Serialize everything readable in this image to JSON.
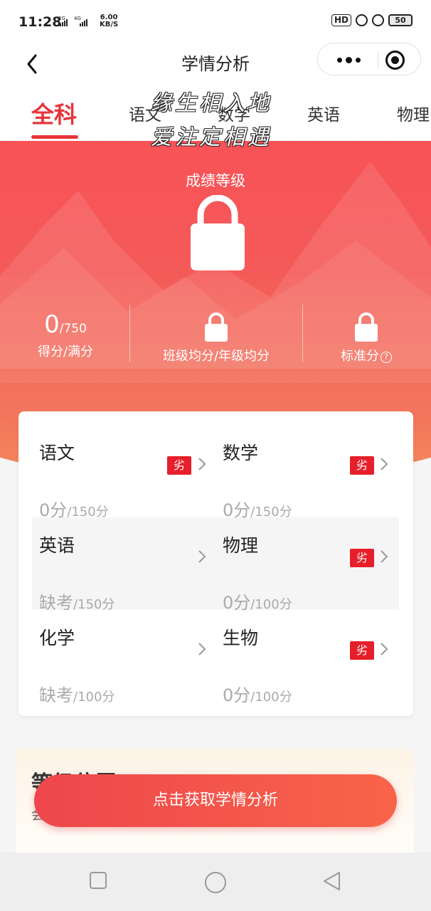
{
  "status_bar": {
    "time": "11:28",
    "signal1": "2G",
    "signal2": "4G",
    "speed": "6.00",
    "speed_unit": "KB/S",
    "hd": "HD",
    "battery": "50"
  },
  "header": {
    "title": "学情分析",
    "back_icon": "chevron-left-icon",
    "more_icon": "more-dots-icon",
    "close_icon": "target-icon"
  },
  "tabs": [
    {
      "label": "全科",
      "active": true
    },
    {
      "label": "语文",
      "active": false
    },
    {
      "label": "数学",
      "active": false
    },
    {
      "label": "英语",
      "active": false
    },
    {
      "label": "物理",
      "active": false
    }
  ],
  "watermark": [
    "缘生相入地",
    "爱注定相遇"
  ],
  "hero": {
    "grade_title": "成绩等级",
    "score": "0",
    "full_score": "/750",
    "score_label": "得分/满分",
    "avg_label": "班级均分/年级均分",
    "std_label": "标准分",
    "help": "?"
  },
  "subjects": [
    {
      "name": "语文",
      "badge": "劣",
      "score": "0分",
      "full": "/150分"
    },
    {
      "name": "数学",
      "badge": "劣",
      "score": "0分",
      "full": "/150分"
    },
    {
      "name": "英语",
      "badge": "",
      "score": "缺考",
      "full": "/150分"
    },
    {
      "name": "物理",
      "badge": "劣",
      "score": "0分",
      "full": "/100分"
    },
    {
      "name": "化学",
      "badge": "",
      "score": "缺考",
      "full": "/100分"
    },
    {
      "name": "生物",
      "badge": "劣",
      "score": "0分",
      "full": "/100分"
    }
  ],
  "bottom_card": {
    "title": "等级位置",
    "subtitle": "会"
  },
  "cta": "点击获取学情分析",
  "colors": {
    "accent": "#e8343b",
    "hero_top": "#f95057",
    "hero_bottom": "#f48a5e",
    "badge": "#e61f2a"
  }
}
